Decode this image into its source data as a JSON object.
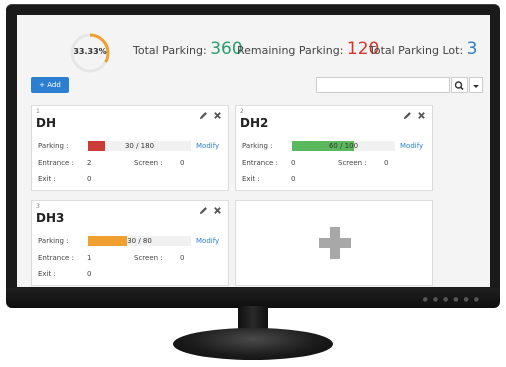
{
  "stats": {
    "percent_label": "33.33%",
    "percent_value": 33.33,
    "total_label": "Total Parking:",
    "total_value": "360",
    "remaining_label": "Remaining Parking:",
    "remaining_value": "120",
    "lots_label": "Total Parking Lot:",
    "lots_value": "3"
  },
  "toolbar": {
    "add_label": "+ Add",
    "search_placeholder": "",
    "search_icon": "search-icon",
    "dropdown_icon": "caret-down-icon"
  },
  "labels": {
    "parking": "Parking :",
    "entrance": "Entrance :",
    "screen": "Screen :",
    "exit": "Exit :",
    "modify": "Modify"
  },
  "colors": {
    "primary": "#2c7fd0",
    "red": "#d9342b",
    "green": "#2a9d6f",
    "bar_red": "#cc3b36",
    "bar_green": "#5cb85c",
    "bar_orange": "#f0a030"
  },
  "lots": [
    {
      "id": "1",
      "name": "DH",
      "used": 30,
      "capacity": 180,
      "usage_text": "30 / 180",
      "entrance": "2",
      "screen": "0",
      "exit": "0",
      "bar_color": "#cc3b36"
    },
    {
      "id": "2",
      "name": "DH2",
      "used": 60,
      "capacity": 100,
      "usage_text": "60 / 100",
      "entrance": "0",
      "screen": "0",
      "exit": "0",
      "bar_color": "#5cb85c"
    },
    {
      "id": "3",
      "name": "DH3",
      "used": 30,
      "capacity": 80,
      "usage_text": "30 / 80",
      "entrance": "1",
      "screen": "0",
      "exit": "0",
      "bar_color": "#f0a030"
    }
  ]
}
